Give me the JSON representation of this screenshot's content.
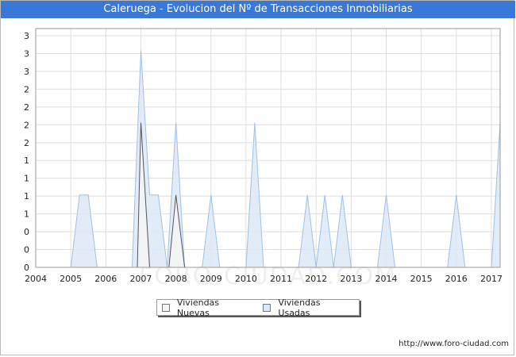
{
  "title": "Caleruega - Evolucion del Nº de Transacciones Inmobiliarias",
  "source": "http://www.foro-ciudad.com",
  "watermark": "FORO-CIUDAD.COM",
  "chart_data": {
    "type": "area",
    "title": "Caleruega - Evolucion del Nº de Transacciones Inmobiliarias",
    "x_ticks": [
      "2004",
      "2005",
      "2006",
      "2007",
      "2008",
      "2009",
      "2010",
      "2011",
      "2012",
      "2013",
      "2014",
      "2015",
      "2016",
      "2017"
    ],
    "y_ticks": [
      "0",
      "0",
      "0",
      "1",
      "1",
      "1",
      "1",
      "2",
      "2",
      "2",
      "2",
      "3",
      "3",
      "3"
    ],
    "xlim": [
      2004,
      2017.25
    ],
    "ylim": [
      0,
      3.3
    ],
    "grid": true,
    "legend_position": "bottom-center",
    "series": [
      {
        "name": "Viviendas Nuevas",
        "color": "#f4f4f4",
        "stroke": "#555555",
        "x": [
          2004,
          2006.9,
          2007,
          2007.25,
          2007.8,
          2008,
          2008.25,
          2017.25
        ],
        "y": [
          0,
          0,
          2,
          0,
          0,
          1,
          0,
          0
        ]
      },
      {
        "name": "Viviendas Usadas",
        "color": "#dde9f8",
        "stroke": "#9fc0e6",
        "x": [
          2004,
          2005,
          2005.25,
          2005.5,
          2005.75,
          2006.75,
          2007,
          2007.25,
          2007.5,
          2007.75,
          2008,
          2008.25,
          2008.75,
          2009,
          2009.25,
          2010,
          2010.25,
          2010.5,
          2011.5,
          2011.75,
          2012,
          2012.25,
          2012.5,
          2012.75,
          2013,
          2013.75,
          2014,
          2014.25,
          2015.75,
          2016,
          2016.25,
          2017,
          2017.25
        ],
        "y": [
          0,
          0,
          1,
          1,
          0,
          0,
          3,
          1,
          1,
          0,
          2,
          0,
          0,
          1,
          0,
          0,
          2,
          0,
          0,
          1,
          0,
          1,
          0,
          1,
          0,
          0,
          1,
          0,
          0,
          1,
          0,
          0,
          2
        ]
      }
    ]
  }
}
